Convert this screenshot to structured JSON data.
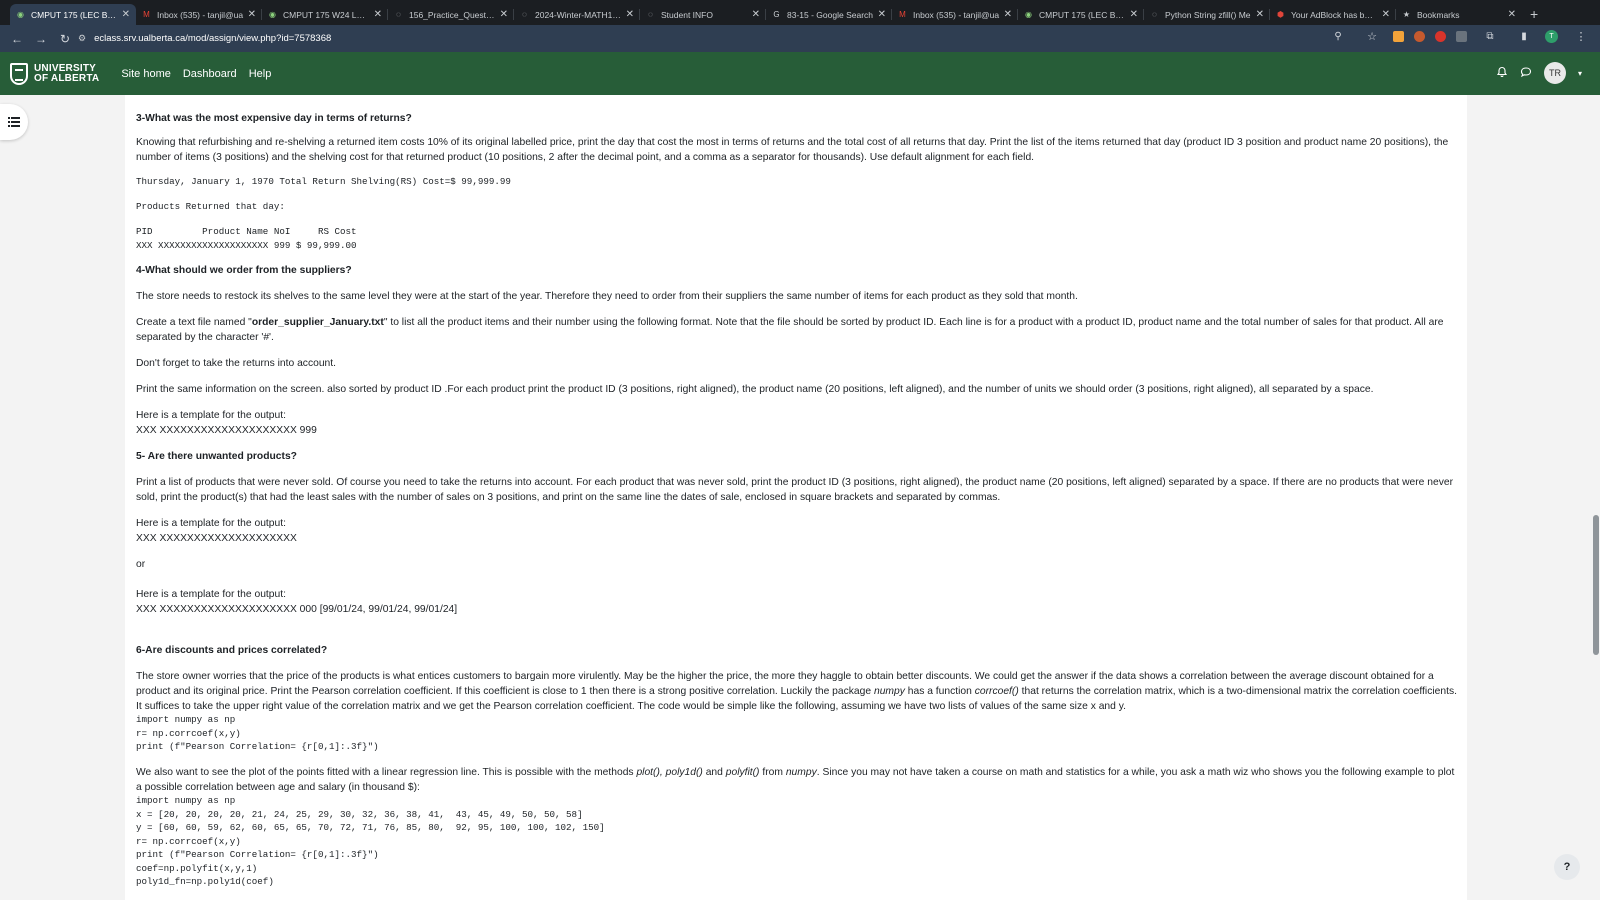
{
  "browser": {
    "tabs": [
      {
        "title": "CMPUT 175 (LEC B1 B2",
        "icon": "moodle-icon",
        "active": true
      },
      {
        "title": "Inbox (535) - tanjil@ua",
        "icon": "gmail-icon",
        "active": false
      },
      {
        "title": "CMPUT 175 W24 Lab I",
        "icon": "moodle-icon",
        "active": false
      },
      {
        "title": "156_Practice_Question",
        "icon": "globe-icon",
        "active": false
      },
      {
        "title": "2024-Winter-MATH156",
        "icon": "globe-icon",
        "active": false
      },
      {
        "title": "Student INFO",
        "icon": "globe-icon",
        "active": false
      },
      {
        "title": "83-15 - Google Search",
        "icon": "google-icon",
        "active": false
      },
      {
        "title": "Inbox (535) - tanjil@ua",
        "icon": "gmail-icon",
        "active": false
      },
      {
        "title": "CMPUT 175 (LEC B1 B2",
        "icon": "moodle-icon",
        "active": false
      },
      {
        "title": "Python String zfill() Me",
        "icon": "globe-icon",
        "active": false
      },
      {
        "title": "Your AdBlock has been",
        "icon": "adblock-icon",
        "active": false
      },
      {
        "title": "Bookmarks",
        "icon": "star-icon",
        "active": false
      }
    ],
    "url": "eclass.srv.ualberta.ca/mod/assign/view.php?id=7578368",
    "profile_initial": "T"
  },
  "site": {
    "logo_line1": "UNIVERSITY",
    "logo_line2": "OF ALBERTA",
    "nav": [
      "Site home",
      "Dashboard",
      "Help"
    ],
    "avatar_initials": "TR"
  },
  "content": {
    "q3_heading": "3-What was the most expensive day in terms of returns?",
    "q3_p1": "Knowing that refurbishing and re-shelving a returned item costs 10% of its original labelled price, print the day that cost the most in terms of returns and the total cost of all returns that day. Print the list of the items returned that day (product ID 3 position and product name 20 positions), the number of items (3 positions) and the shelving cost for that returned product (10 positions, 2 after the decimal point, and a comma as a separator for thousands). Use default alignment for each field.",
    "q3_code1": "Thursday, January 1, 1970 Total Return Shelving(RS) Cost=$ 99,999.99",
    "q3_code2": "Products Returned that day:",
    "q3_code3": "PID         Product Name NoI     RS Cost\nXXX XXXXXXXXXXXXXXXXXXXX 999 $ 99,999.00",
    "q4_heading": "4-What should we order from the suppliers?",
    "q4_p1": "The store needs to restock its shelves to the same level they were at the start of the year. Therefore they need to order from their suppliers the same number of items for each product as they sold that month.",
    "q4_p2_a": "Create a text file named \"",
    "q4_p2_b": "order_supplier_January.txt",
    "q4_p2_c": "\" to list all the product items and their number using the following format. Note that the file should be sorted by product ID. Each line is for a product with a product ID, product name and the total number of sales for that product. All are separated by the character '#'.",
    "q4_p3": "Don't forget to take the returns into account.",
    "q4_p4": "Print the same information on the screen. also sorted by product ID .For each product  print the product ID (3 positions, right aligned), the product name (20 positions, left aligned), and the number of units we should order (3 positions, right aligned), all separated by a space.",
    "q4_template_label": "Here is a template for the output:",
    "q4_template": "XXX XXXXXXXXXXXXXXXXXXXX 999",
    "q5_heading": "5- Are there unwanted products?",
    "q5_p1": "Print a list of products that were never sold. Of course you need to take the returns into account. For each product that was never sold, print the product ID (3 positions, right aligned), the product name (20 positions, left aligned) separated by a space. If there are no products that were never sold, print the product(s) that had the least sales with the number of sales on 3 positions, and print on the same line the dates of sale, enclosed in square brackets and separated by commas.",
    "q5_template_label1": "Here is a template for the output:",
    "q5_template1": "XXX XXXXXXXXXXXXXXXXXXXX",
    "q5_or": "or",
    "q5_template_label2": "Here is a template for the output:",
    "q5_template2": "XXX XXXXXXXXXXXXXXXXXXXX 000 [99/01/24, 99/01/24, 99/01/24]",
    "q6_heading": "6-Are discounts and prices correlated?",
    "q6_p1_a": "The store owner worries that the price of the products is what entices customers to bargain more virulently. May be the higher the price, the more they haggle to obtain better discounts. We could get the answer if the data shows a correlation between the average discount obtained for a product and its original price. Print the Pearson correlation coefficient. If this coefficient is close to 1 then there is a strong positive correlation. Luckily the package ",
    "q6_p1_b": "numpy",
    "q6_p1_c": " has a function ",
    "q6_p1_d": "corrcoef()",
    "q6_p1_e": " that returns the correlation matrix, which is a two-dimensional matrix the correlation coefficients. It suffices to take the upper right value of the correlation matrix and we get the Pearson correlation coefficient.  The code would be simple like the following, assuming we have two lists of values of the same size x and y.",
    "q6_code1": "import numpy as np\nr= np.corrcoef(x,y)\nprint (f\"Pearson Correlation= {r[0,1]:.3f}\")",
    "q6_p2_a": "We also want to see the plot of the points fitted with a linear regression line. This is possible with the methods ",
    "q6_p2_b": "plot(), poly1d()",
    "q6_p2_c": " and ",
    "q6_p2_d": "polyfit()",
    "q6_p2_e": " from ",
    "q6_p2_f": "numpy",
    "q6_p2_g": ". Since you may not have taken a course on math and statistics for a while, you ask a math wiz who shows you the following example to plot a possible correlation between age and salary (in thousand $):",
    "q6_code2": "import numpy as np\nx = [20, 20, 20, 20, 21, 24, 25, 29, 30, 32, 36, 38, 41,  43, 45, 49, 50, 50, 58]\ny = [60, 60, 59, 62, 60, 65, 65, 70, 72, 71, 76, 85, 80,  92, 95, 100, 100, 102, 150]\nr= np.corrcoef(x,y)\nprint (f\"Pearson Correlation= {r[0,1]:.3f}\")\ncoef=np.polyfit(x,y,1)\npoly1d_fn=np.poly1d(coef)"
  },
  "help_label": "?"
}
